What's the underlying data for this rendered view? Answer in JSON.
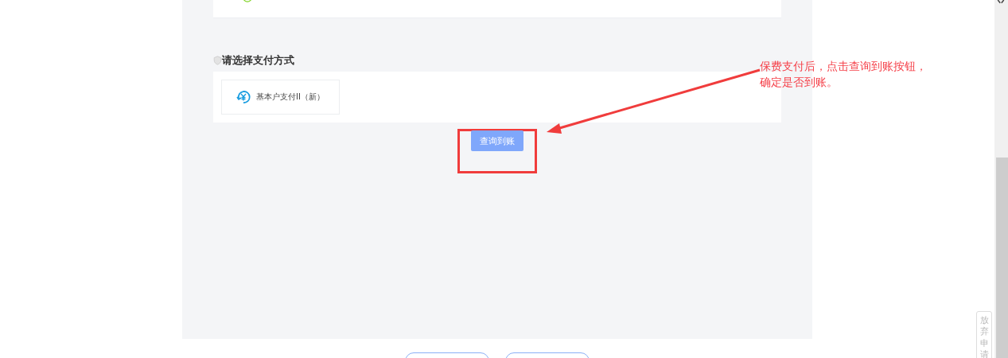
{
  "section_title": "请选择支付方式",
  "payment_options": [
    {
      "label": "基本户支付II（新）"
    }
  ],
  "query_button": "查询到账",
  "annotation": [
    "保费支付后，点击查询到账按钮，",
    "确定是否到账。"
  ],
  "side_button": "放弃申请"
}
